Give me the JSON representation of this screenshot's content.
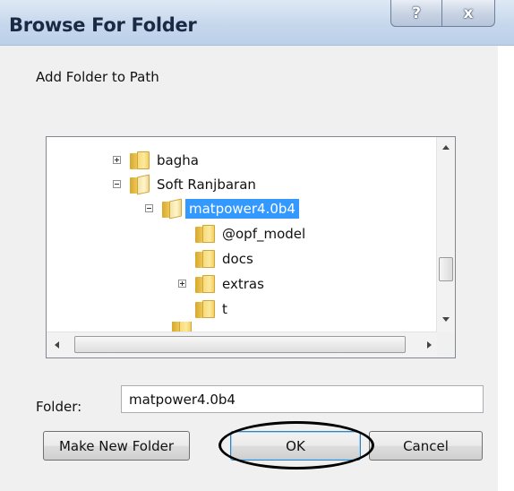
{
  "window": {
    "title": "Browse For Folder",
    "help_glyph": "?",
    "close_glyph": "x"
  },
  "prompt": "Add Folder to Path",
  "tree": {
    "items": [
      {
        "label": "bagha",
        "expander": "+",
        "selected": false
      },
      {
        "label": "Soft Ranjbaran",
        "expander": "-",
        "selected": false
      },
      {
        "label": "matpower4.0b4",
        "expander": "-",
        "selected": true
      },
      {
        "label": "@opf_model",
        "expander": "",
        "selected": false
      },
      {
        "label": "docs",
        "expander": "",
        "selected": false
      },
      {
        "label": "extras",
        "expander": "+",
        "selected": false
      },
      {
        "label": "t",
        "expander": "",
        "selected": false
      }
    ]
  },
  "folder_field": {
    "label": "Folder:",
    "value": "matpower4.0b4"
  },
  "buttons": {
    "make_new_folder": "Make New Folder",
    "ok": "OK",
    "cancel": "Cancel"
  },
  "colors": {
    "selection": "#3399ff",
    "titlebar": "#c6d7ec"
  }
}
